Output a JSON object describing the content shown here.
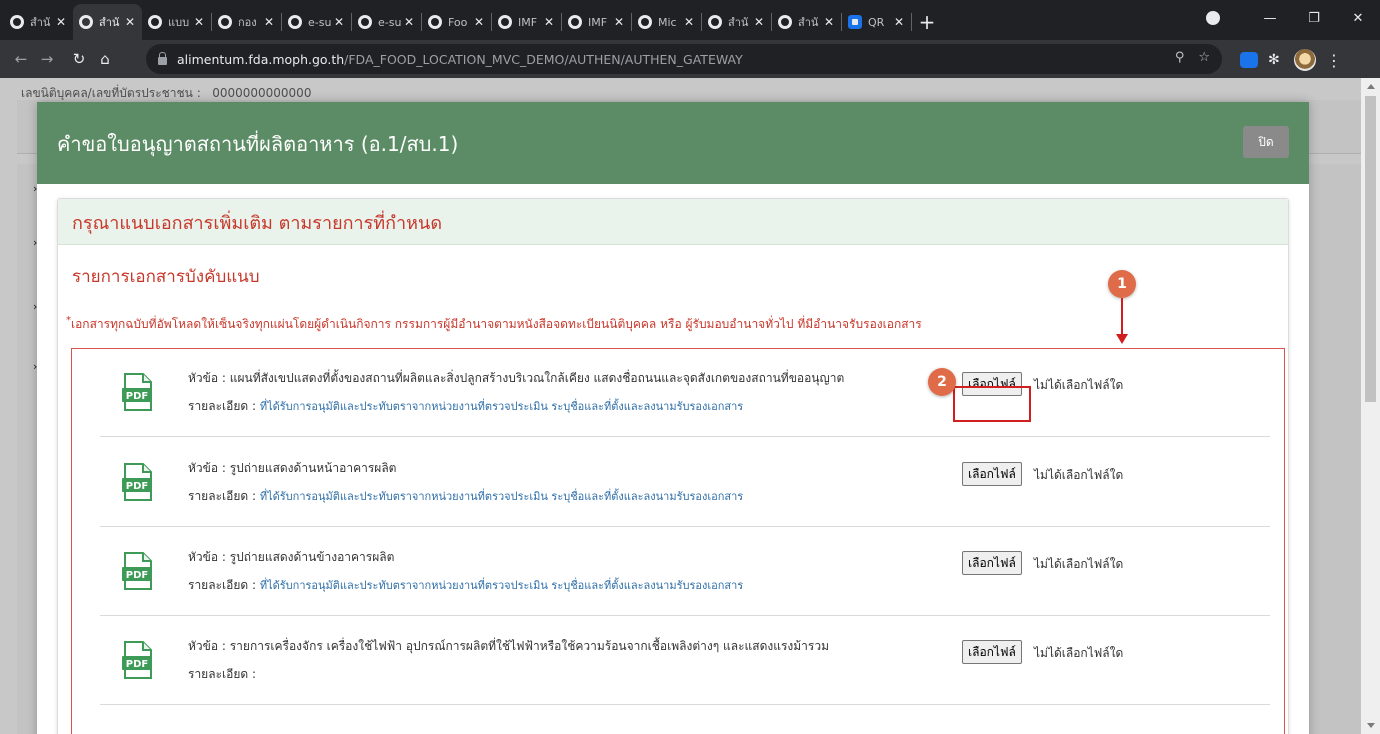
{
  "browser": {
    "tabs": [
      {
        "title": "สำนั",
        "icon": "globe-icon",
        "active": false
      },
      {
        "title": "สำนั",
        "icon": "globe-icon",
        "active": true
      },
      {
        "title": "แบบ",
        "icon": "globe-icon",
        "active": false
      },
      {
        "title": "กอง",
        "icon": "globe-icon",
        "active": false
      },
      {
        "title": "e-su",
        "icon": "globe-icon",
        "active": false
      },
      {
        "title": "e-su",
        "icon": "globe-icon",
        "active": false
      },
      {
        "title": "Foo",
        "icon": "globe-icon",
        "active": false
      },
      {
        "title": "IMF",
        "icon": "globe-icon",
        "active": false
      },
      {
        "title": "IMF",
        "icon": "globe-icon",
        "active": false
      },
      {
        "title": "Mic",
        "icon": "globe-icon",
        "active": false
      },
      {
        "title": "สำนั",
        "icon": "globe-icon",
        "active": false
      },
      {
        "title": "สำนั",
        "icon": "globe-icon",
        "active": false
      },
      {
        "title": "QR",
        "icon": "qr-icon",
        "active": false
      }
    ],
    "new_tab": "+",
    "url_host": "alimentum.fda.moph.go.th",
    "url_path": "/FDA_FOOD_LOCATION_MVC_DEMO/AUTHEN/AUTHEN_GATEWAY"
  },
  "page": {
    "id_label": "เลขนิติบุคคล/เลขที่บัตรประชาชน :",
    "id_value": "0000000000000"
  },
  "modal": {
    "title": "คำขอใบอนุญาตสถานที่ผลิตอาหาร (อ.1/สบ.1)",
    "close_label": "ปิด",
    "panel_heading": "กรุณาแนบเอกสารเพิ่มเติม ตามรายการที่กำหนด",
    "section_title": "รายการเอกสารบังคับแนบ",
    "note_mark": "*",
    "note": "เอกสารทุกฉบับที่อัพโหลดให้เซ็นจริงทุกแผ่นโดยผู้ดำเนินกิจการ กรรมการผู้มีอำนาจตามหนังสือจดทะเบียนนิติบุคคล หรือ ผู้รับมอบอำนาจทั่วไป ที่มีอำนาจรับรองเอกสาร",
    "file_button": "เลือกไฟล์",
    "no_file": "ไม่ได้เลือกไฟล์ใด",
    "documents": [
      {
        "subject": "หัวข้อ : แผนที่สังเขปแสดงที่ตั้งของสถานที่ผลิตและสิ่งปลูกสร้างบริเวณใกล้เคียง แสดงชื่อถนนและจุดสังเกตของสถานที่ขออนุญาต",
        "detail_label": "รายละเอียด :",
        "detail_text": "ที่ได้รับการอนุมัติและประทับตราจากหน่วยงานที่ตรวจประเมิน ระบุชื่อและที่ตั้งและลงนามรับรองเอกสาร"
      },
      {
        "subject": "หัวข้อ : รูปถ่ายแสดงด้านหน้าอาคารผลิต",
        "detail_label": "รายละเอียด :",
        "detail_text": "ที่ได้รับการอนุมัติและประทับตราจากหน่วยงานที่ตรวจประเมิน ระบุชื่อและที่ตั้งและลงนามรับรองเอกสาร"
      },
      {
        "subject": "หัวข้อ : รูปถ่ายแสดงด้านข้างอาคารผลิต",
        "detail_label": "รายละเอียด :",
        "detail_text": "ที่ได้รับการอนุมัติและประทับตราจากหน่วยงานที่ตรวจประเมิน ระบุชื่อและที่ตั้งและลงนามรับรองเอกสาร"
      },
      {
        "subject": "หัวข้อ : รายการเครื่องจักร เครื่องใช้ไฟฟ้า อุปกรณ์การผลิตที่ใช้ไฟฟ้าหรือใช้ความร้อนจากเชื้อเพลิงต่างๆ และแสดงแรงม้ารวม",
        "detail_label": "รายละเอียด :",
        "detail_text": ""
      }
    ],
    "annotations": {
      "badge_1": "1",
      "badge_2": "2"
    }
  },
  "colors": {
    "header_green": "#5c8c66",
    "accent_red": "#c7372a",
    "link_blue": "#2f6fa8",
    "badge_orange": "#e06b48"
  }
}
